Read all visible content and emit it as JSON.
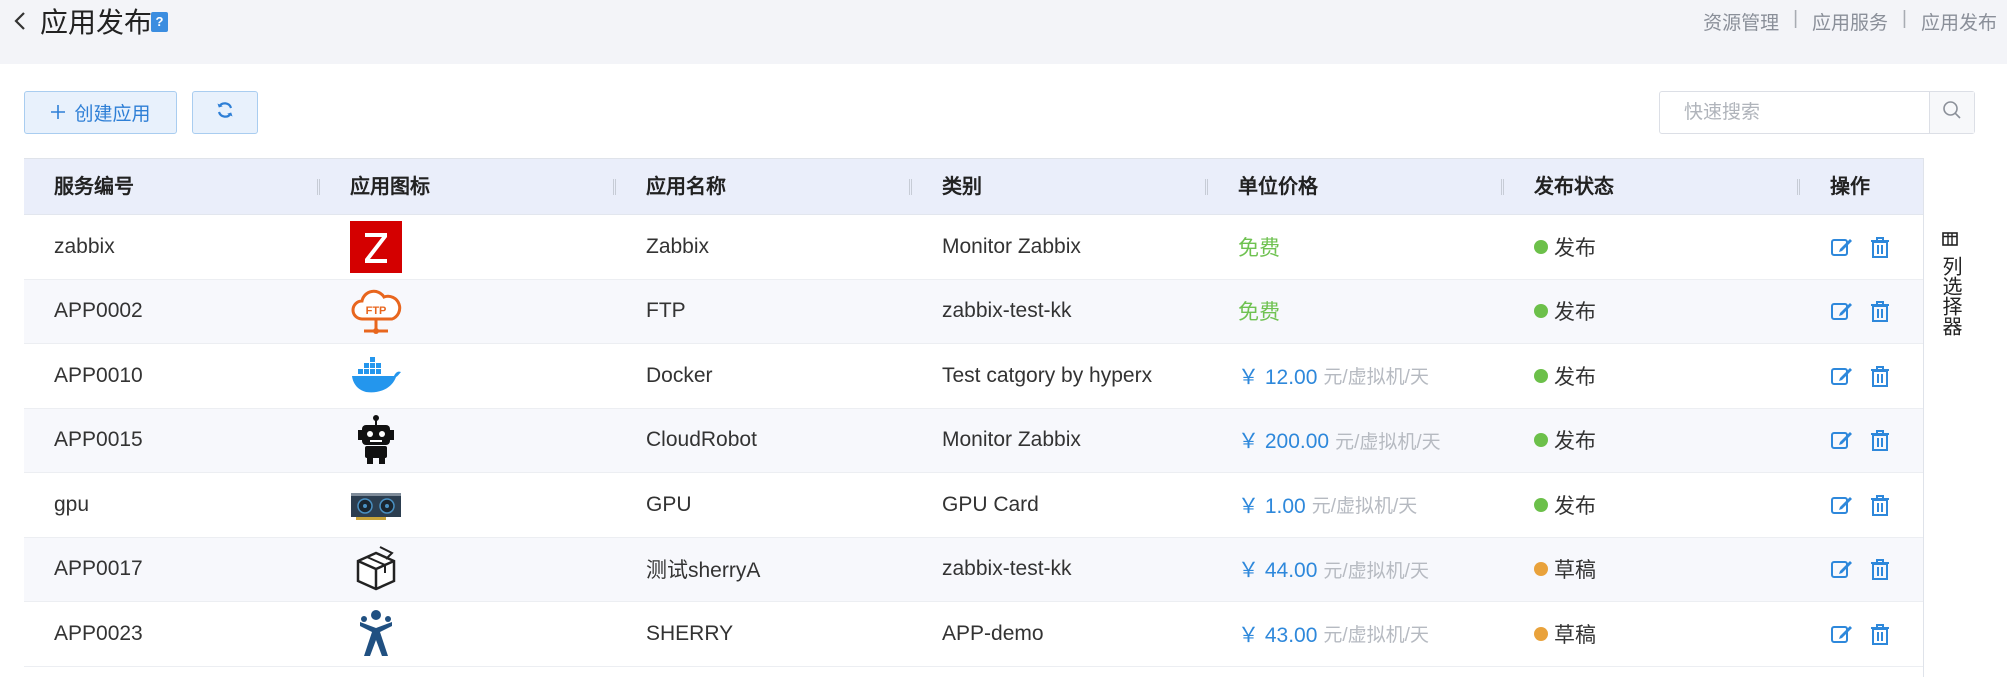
{
  "header": {
    "back_icon": "chevron-left-icon",
    "title": "应用发布",
    "help_icon": "help-book-icon",
    "help_glyph": "?",
    "breadcrumb": [
      "资源管理",
      "应用服务",
      "应用发布"
    ],
    "breadcrumb_sep": "|"
  },
  "toolbar": {
    "create_label": "创建应用",
    "create_icon": "plus-icon",
    "refresh_icon": "refresh-icon",
    "search_placeholder": "快速搜索",
    "search_icon": "search-icon"
  },
  "table": {
    "columns": [
      "服务编号",
      "应用图标",
      "应用名称",
      "类别",
      "单位价格",
      "发布状态",
      "操作"
    ],
    "rows": [
      {
        "id": "zabbix",
        "icon": "zabbix-logo-icon",
        "name": "Zabbix",
        "category": "Monitor Zabbix",
        "price_text": "免费",
        "free": true,
        "status": "发布"
      },
      {
        "id": "APP0002",
        "icon": "ftp-cloud-icon",
        "name": "FTP",
        "category": "zabbix-test-kk",
        "price_text": "免费",
        "free": true,
        "status": "发布"
      },
      {
        "id": "APP0010",
        "icon": "docker-whale-icon",
        "name": "Docker",
        "category": "Test catgory by hyperx",
        "price_text": "￥ 12.00",
        "unit": "元/虚拟机/天",
        "free": false,
        "status": "发布"
      },
      {
        "id": "APP0015",
        "icon": "robot-icon",
        "name": "CloudRobot",
        "category": "Monitor Zabbix",
        "price_text": "￥ 200.00",
        "unit": "元/虚拟机/天",
        "free": false,
        "status": "发布"
      },
      {
        "id": "gpu",
        "icon": "gpu-card-icon",
        "name": "GPU",
        "category": "GPU Card",
        "price_text": "￥ 1.00",
        "unit": "元/虚拟机/天",
        "free": false,
        "status": "发布"
      },
      {
        "id": "APP0017",
        "icon": "package-box-icon",
        "name": "测试sherryA",
        "category": "zabbix-test-kk",
        "price_text": "￥ 44.00",
        "unit": "元/虚拟机/天",
        "free": false,
        "status": "草稿"
      },
      {
        "id": "APP0023",
        "icon": "jira-person-icon",
        "name": "SHERRY",
        "category": "APP-demo",
        "price_text": "￥ 43.00",
        "unit": "元/虚拟机/天",
        "free": false,
        "status": "草稿"
      }
    ],
    "row_actions": [
      "edit-icon",
      "delete-icon"
    ]
  },
  "column_selector": {
    "label": "列选择器",
    "icon": "columns-icon"
  },
  "colors": {
    "accent": "#2e88db",
    "free": "#6fc251",
    "published_dot": "#6cc04a",
    "draft_dot": "#e9a23b"
  }
}
